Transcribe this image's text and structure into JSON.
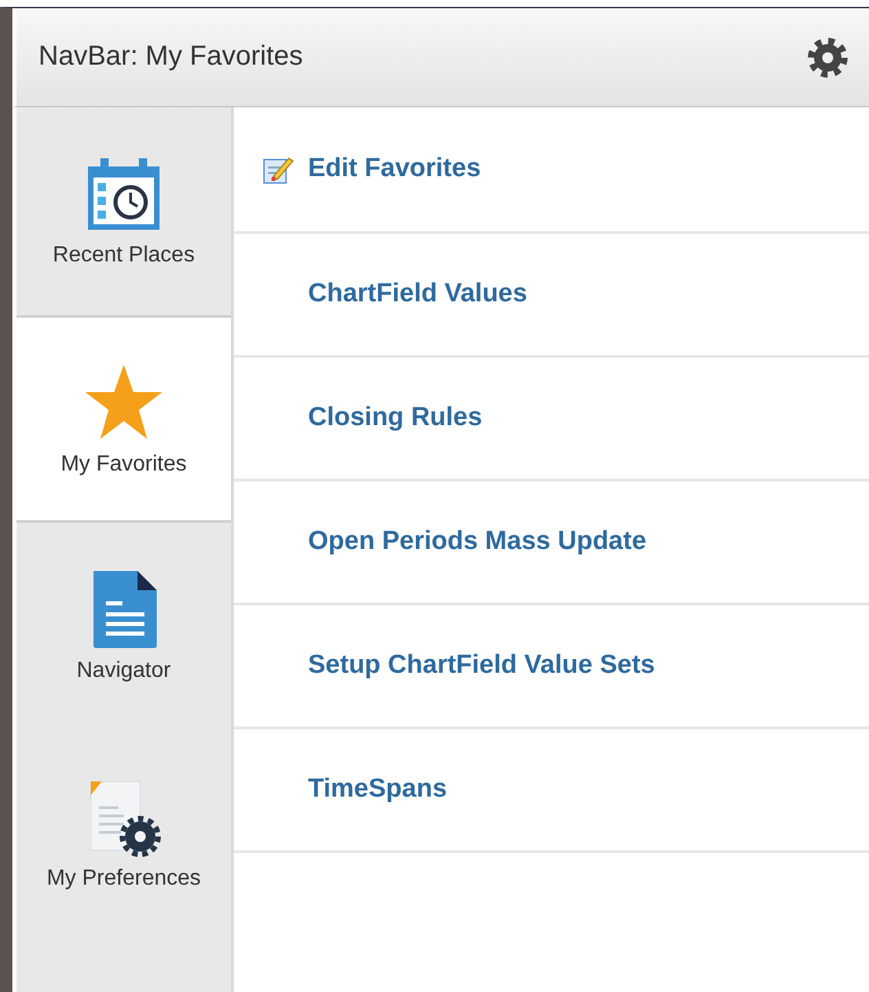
{
  "header": {
    "title": "NavBar: My Favorites"
  },
  "sidebar": {
    "items": [
      {
        "label": "Recent Places",
        "kind": "calendar",
        "selected": false
      },
      {
        "label": "My Favorites",
        "kind": "star",
        "selected": true
      },
      {
        "label": "Navigator",
        "kind": "document",
        "selected": false
      },
      {
        "label": "My Preferences",
        "kind": "preferences",
        "selected": false
      }
    ]
  },
  "favorites": {
    "items": [
      {
        "label": "Edit Favorites",
        "kind": "edit"
      },
      {
        "label": "ChartField Values",
        "kind": "link"
      },
      {
        "label": "Closing Rules",
        "kind": "link"
      },
      {
        "label": "Open Periods Mass Update",
        "kind": "link"
      },
      {
        "label": "Setup ChartField Value Sets",
        "kind": "link"
      },
      {
        "label": "TimeSpans",
        "kind": "link"
      }
    ]
  }
}
